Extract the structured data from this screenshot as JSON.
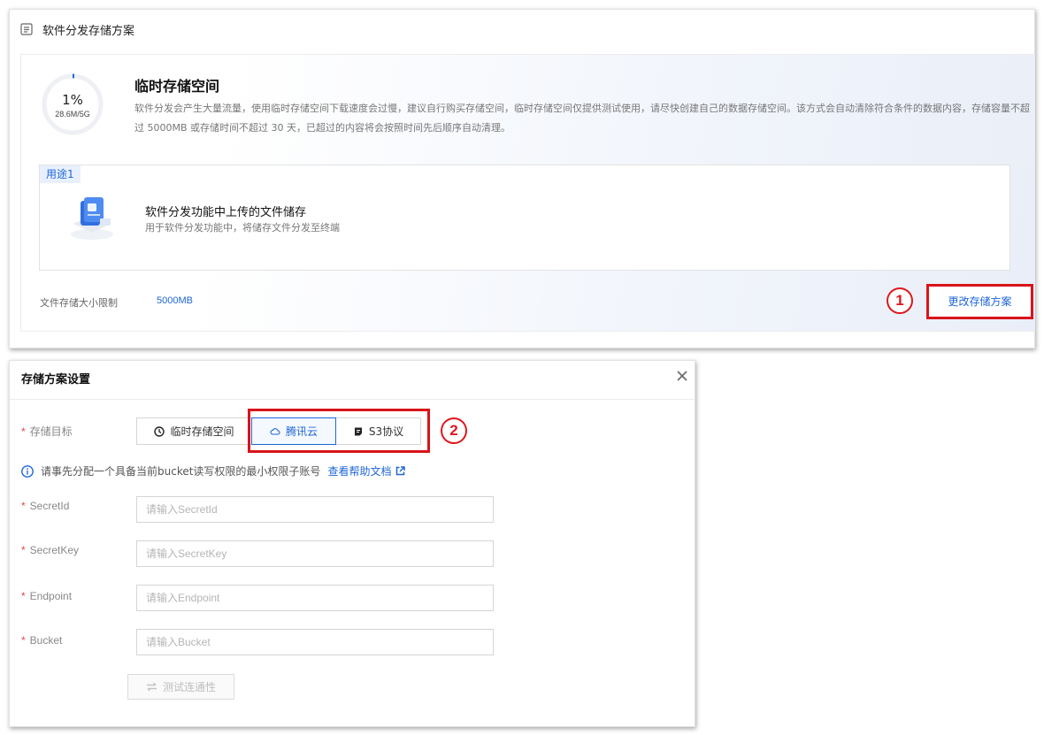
{
  "panel": {
    "title": "软件分发存储方案"
  },
  "storage": {
    "percent_text": "1%",
    "usage_text": "28.6M/5G",
    "usage_fraction": 0.01,
    "title": "临时存储空间",
    "description": "软件分发会产生大量流量，使用临时存储空间下载速度会过慢，建议自行购买存储空间，临时存储空间仅提供测试使用，请尽快创建自己的数据存储空间。该方式会自动清除符合条件的数据内容，存储容量不超过 5000MB 或存储时间不超过 30 天，已超过的内容将会按照时间先后顺序自动清理。"
  },
  "usage": {
    "tag": "用途1",
    "title": "软件分发功能中上传的文件储存",
    "description": "用于软件分发功能中，将储存文件分发至终端"
  },
  "limit": {
    "label": "文件存储大小限制",
    "value": "5000MB"
  },
  "change_button": "更改存储方案",
  "badges": {
    "step1": "1",
    "step2": "2"
  },
  "dialog": {
    "title": "存储方案设置",
    "target_label": "存储目标",
    "target_options": [
      "临时存储空间",
      "腾讯云",
      "S3协议"
    ],
    "selected_target": "腾讯云",
    "info_text": "请事先分配一个具备当前bucket读写权限的最小权限子账号",
    "help_link": "查看帮助文档",
    "fields": [
      {
        "label": "SecretId",
        "placeholder": "请输入SecretId",
        "value": ""
      },
      {
        "label": "SecretKey",
        "placeholder": "请输入SecretKey",
        "value": ""
      },
      {
        "label": "Endpoint",
        "placeholder": "请输入Endpoint",
        "value": ""
      },
      {
        "label": "Bucket",
        "placeholder": "请输入Bucket",
        "value": ""
      }
    ],
    "test_button": "测试连通性"
  },
  "colors": {
    "accent": "#1f66d6",
    "annotation_red": "#d9141a",
    "required": "#e54545"
  }
}
